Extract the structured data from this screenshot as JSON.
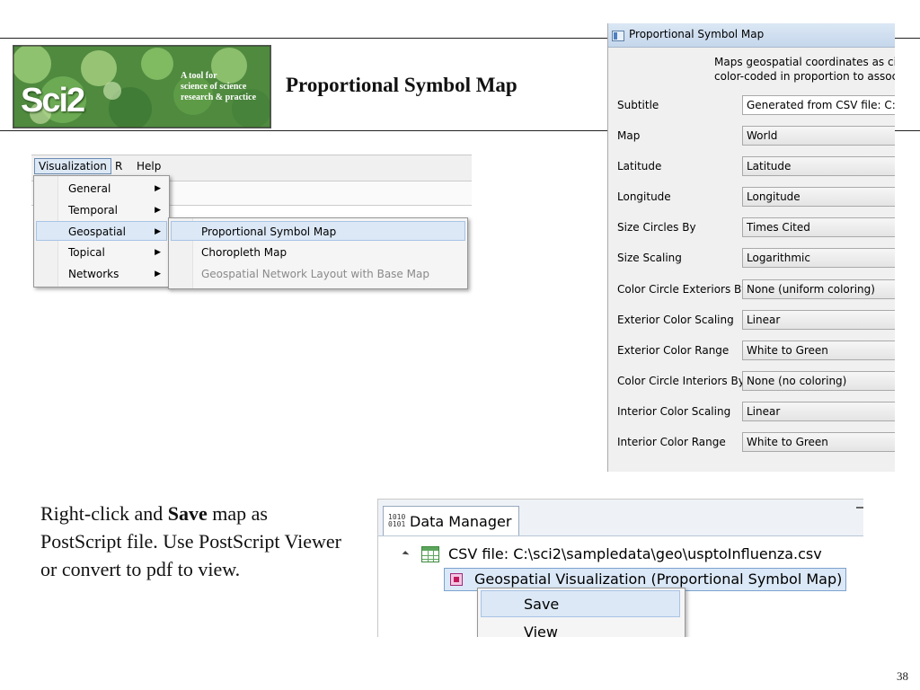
{
  "slide": {
    "title": "Proportional Symbol Map",
    "page_number": "38"
  },
  "logo": {
    "brand": "Sci2",
    "tagline_1": "A tool for",
    "tagline_2": "science of science",
    "tagline_3": "research & practice"
  },
  "menubar": {
    "items": [
      "Visualization",
      "R",
      "Help"
    ]
  },
  "viz_menu": {
    "items": [
      "General",
      "Temporal",
      "Geospatial",
      "Topical",
      "Networks"
    ],
    "selected": "Geospatial"
  },
  "geospatial_submenu": {
    "items": [
      "Proportional Symbol Map",
      "Choropleth Map",
      "Geospatial Network Layout with Base Map"
    ],
    "selected": "Proportional Symbol Map",
    "disabled": "Geospatial Network Layout with Base Map"
  },
  "dialog": {
    "title": "Proportional Symbol Map",
    "description_line1": "Maps geospatial coordinates as circ",
    "description_line2": "color-coded in proportion to associ",
    "fields": [
      {
        "label": "Subtitle",
        "value": "Generated from CSV file: C:\\s"
      },
      {
        "label": "Map",
        "value": "World"
      },
      {
        "label": "Latitude",
        "value": "Latitude"
      },
      {
        "label": "Longitude",
        "value": "Longitude"
      },
      {
        "label": "Size Circles By",
        "value": "Times Cited"
      },
      {
        "label": "Size Scaling",
        "value": "Logarithmic"
      },
      {
        "label": "Color Circle Exteriors By",
        "value": "None (uniform coloring)"
      },
      {
        "label": "Exterior Color Scaling",
        "value": "Linear"
      },
      {
        "label": "Exterior Color Range",
        "value": "White to Green"
      },
      {
        "label": "Color Circle Interiors By",
        "value": "None (no coloring)"
      },
      {
        "label": "Interior Color Scaling",
        "value": "Linear"
      },
      {
        "label": "Interior Color Range",
        "value": "White to Green"
      }
    ]
  },
  "instructions": {
    "part1": "Right-click and ",
    "bold": "Save",
    "part2": " map as PostScript file. Use PostScript Viewer or convert to pdf  to view."
  },
  "data_manager": {
    "tab_icon": "1010\n0101",
    "tab_label": "Data Manager",
    "csv_item": "CSV file: C:\\sci2\\sampledata\\geo\\usptoInfluenza.csv",
    "geo_item": "Geospatial Visualization (Proportional Symbol Map)",
    "context_menu": [
      "Save",
      "View"
    ]
  }
}
